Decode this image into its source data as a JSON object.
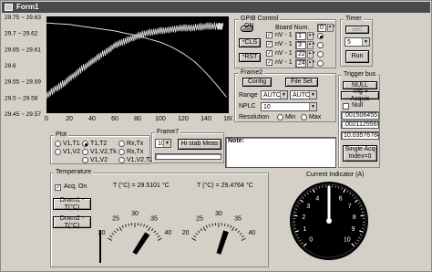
{
  "window": {
    "title": "Form1"
  },
  "chart_data": {
    "type": "line",
    "title": "",
    "xlabel": "",
    "ylabel": "",
    "xlim": [
      0,
      160
    ],
    "ylim": [
      29.45,
      29.75
    ],
    "x_ticks": [
      "0",
      "20",
      "40",
      "60",
      "80",
      "100",
      "120",
      "140",
      "160"
    ],
    "y_ticks": [
      "29.75 ~ 29.63",
      "29.7 ~ 29.62",
      "29.65 ~ 29.61",
      "29.6",
      "29.55 ~ 29.59",
      "29.5 ~ 29.58",
      "29.45 ~ 29.57"
    ],
    "grid": false,
    "series": [
      {
        "name": "",
        "x": [
          0,
          10,
          20,
          30,
          40,
          50,
          60,
          70,
          80,
          90,
          100,
          110,
          120,
          130,
          140,
          150,
          155
        ],
        "y": [
          29.505,
          29.53,
          29.555,
          29.585,
          29.61,
          29.635,
          29.66,
          29.675,
          29.69,
          29.7,
          29.705,
          29.71,
          29.715,
          29.715,
          29.72,
          29.72,
          29.72
        ]
      },
      {
        "name": "",
        "x": [
          0,
          20,
          40,
          60,
          80,
          100,
          110,
          120,
          130,
          140,
          150,
          158
        ],
        "y": [
          29.73,
          29.725,
          29.715,
          29.705,
          29.69,
          29.67,
          29.655,
          29.635,
          29.61,
          29.575,
          29.535,
          29.5
        ]
      }
    ]
  },
  "gpib": {
    "title": "GPIB Control",
    "on_label": "ON",
    "board_label": "Board Num.",
    "board_value": "0",
    "cls_label": "*CLS",
    "rst_label": "*RST",
    "rows": [
      {
        "label": "nV - 1",
        "value": "1"
      },
      {
        "label": "nV - 1",
        "value": "3"
      },
      {
        "label": "nV - 1",
        "value": "22"
      },
      {
        "label": "nV - 1",
        "value": "24"
      }
    ]
  },
  "timer": {
    "title": "Timer",
    "sec_label": "sec",
    "value": "5",
    "run_label": "Run"
  },
  "frame2": {
    "title": "Frame2",
    "config_label": "Config",
    "fileset_label": "File Set",
    "range_label": "Range",
    "range_value1": "AUTO",
    "range_value2": "AUTO",
    "nplc_label": "NPLC",
    "nplc_value": "10",
    "resolution_label": "Resolution",
    "min_label": "Min",
    "max_label": "Max"
  },
  "trigger": {
    "title": "Trigger bus",
    "null_btn": "NULL",
    "trig_btn": "Trig + Acquis",
    "null_check": "Null",
    "value1": ".001506455",
    "value2": ".0021125565",
    "value3": "10.035767845",
    "single_btn_line1": "Single Acq",
    "single_btn_line2": "Index=0"
  },
  "plot": {
    "title": "Plot",
    "options": [
      "V1,T1",
      "T1,T2",
      "Rx,Tx",
      "V1,V2",
      "V1,V2,Tk",
      "Rx,Tx",
      "V1,V2",
      "V1,V2,T2"
    ]
  },
  "frame7": {
    "title": "Frame7",
    "value": "10",
    "hi_btn": "Hi stab Meas",
    "note_label": "Note:"
  },
  "temperature": {
    "title": "Temperature",
    "acq_label": "Acq. On",
    "draw1_label": "Drwm1 - T(°C)",
    "draw2_label": "Drwm2 - T(°C)",
    "gauge1_reading": "T (°C) = 29.5101  °C",
    "gauge2_reading": "T (°C) = 29.4764  °C",
    "gauge_ticks": [
      "20",
      "25",
      "30",
      "35",
      "40"
    ]
  },
  "current_indicator": {
    "title": "Current Indicator (A)",
    "dial_ticks": [
      "0",
      "1",
      "2",
      "3",
      "4",
      "5",
      "6",
      "7",
      "8",
      "9",
      "10"
    ],
    "needle_value": 0
  }
}
